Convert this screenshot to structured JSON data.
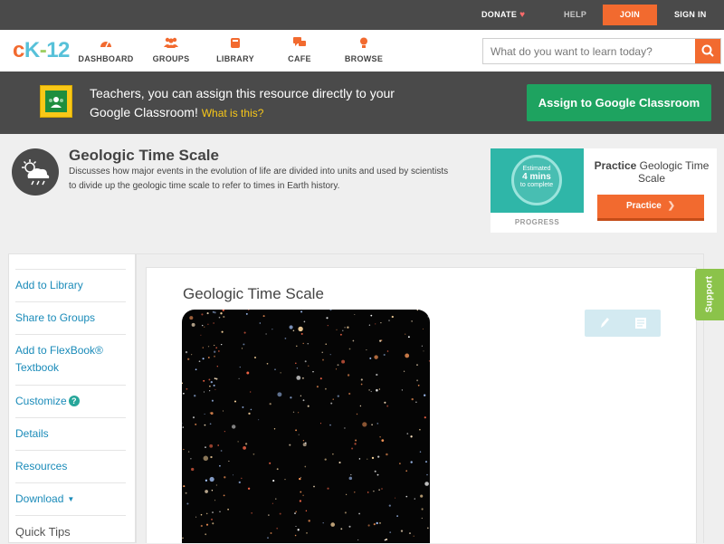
{
  "topbar": {
    "donate": "DONATE",
    "help": "HELP",
    "join": "JOIN",
    "signin": "SIGN IN"
  },
  "logo": {
    "part1": "c",
    "part2": "K",
    "part3": "-",
    "part4": "12"
  },
  "nav": {
    "items": [
      {
        "label": "DASHBOARD",
        "icon": "dashboard-icon"
      },
      {
        "label": "GROUPS",
        "icon": "groups-icon"
      },
      {
        "label": "LIBRARY",
        "icon": "library-icon"
      },
      {
        "label": "CAFE",
        "icon": "cafe-icon"
      },
      {
        "label": "BROWSE",
        "icon": "browse-icon"
      }
    ],
    "search_placeholder": "What do you want to learn today?"
  },
  "banner": {
    "message": "Teachers, you can assign this resource directly to your Google Classroom!",
    "what_link": "What is this?",
    "assign_button": "Assign to Google Classroom"
  },
  "concept": {
    "title": "Geologic Time Scale",
    "description": "Discusses how major events in the evolution of life are divided into units and used by scientists to divide up the geologic time scale to refer to times in Earth history."
  },
  "practice": {
    "estimate_line1": "Estimated",
    "estimate_line2": "4 mins",
    "estimate_line3": "to complete",
    "progress_label": "PROGRESS",
    "title_bold": "Practice",
    "title_rest": "Geologic Time Scale",
    "button": "Practice"
  },
  "sidebar": {
    "items": [
      {
        "label": "Add to Library"
      },
      {
        "label": "Share to Groups"
      },
      {
        "label": "Add to FlexBook® Textbook"
      },
      {
        "label": "Customize"
      },
      {
        "label": "Details"
      },
      {
        "label": "Resources"
      },
      {
        "label": "Download"
      },
      {
        "label": "Quick Tips"
      }
    ],
    "help_mark": "?",
    "caret": "▼"
  },
  "content": {
    "title": "Geologic Time Scale"
  },
  "support": "Support",
  "colors": {
    "brand_orange": "#f26a2f",
    "google_green": "#1ea360",
    "link_blue": "#1a8bb9",
    "support_green": "#8bc34a"
  }
}
